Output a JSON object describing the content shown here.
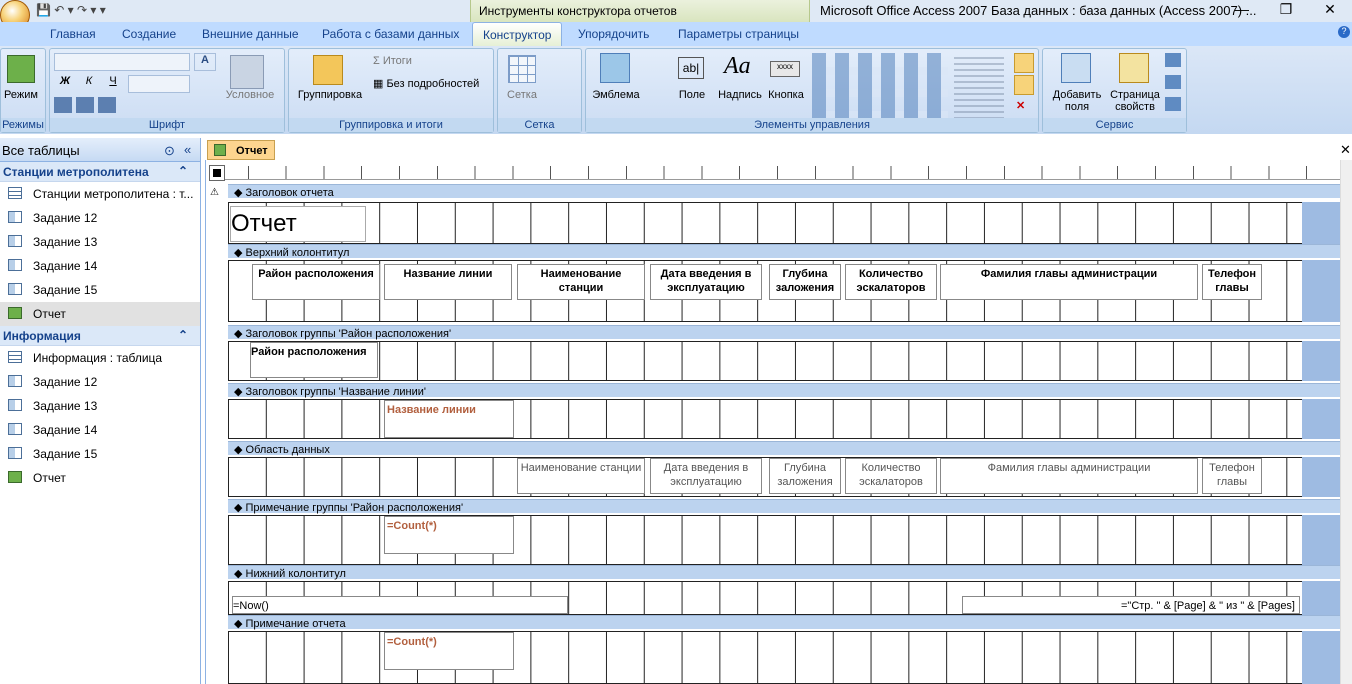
{
  "window": {
    "contextual_tools": "Инструменты конструктора отчетов",
    "title": "Microsoft Office Access 2007 База данных : база данных (Access 2007) ..."
  },
  "tabs": [
    "Главная",
    "Создание",
    "Внешние данные",
    "Работа с базами данных",
    "Конструктор",
    "Упорядочить",
    "Параметры страницы"
  ],
  "ribbon": {
    "groups": [
      "Режимы",
      "Шрифт",
      "Группировка и итоги",
      "Сетка",
      "Элементы управления",
      "Сервис"
    ],
    "view": "Режим",
    "conditional": "Условное",
    "grouping": "Группировка",
    "totals": "Итоги",
    "no_details": "Без подробностей",
    "grid": "Сетка",
    "logo": "Эмблема",
    "field": "Поле",
    "label": "Надпись",
    "button": "Кнопка",
    "add_fields": "Добавить поля",
    "property_sheet": "Страница свойств",
    "bold": "Ж",
    "italic": "К",
    "underline": "Ч"
  },
  "nav": {
    "header": "Все таблицы",
    "groups": [
      {
        "title": "Станции метрополитена",
        "items": [
          "Станции метрополитена : т...",
          "Задание 12",
          "Задание 13",
          "Задание 14",
          "Задание 15",
          "Отчет"
        ]
      },
      {
        "title": "Информация",
        "items": [
          "Информация : таблица",
          "Задание 12",
          "Задание 13",
          "Задание 14",
          "Задание 15",
          "Отчет"
        ]
      }
    ]
  },
  "doc": {
    "tab": "Отчет",
    "sections": [
      "Заголовок отчета",
      "Верхний колонтитул",
      "Заголовок группы 'Район расположения'",
      "Заголовок группы 'Название линии'",
      "Область данных",
      "Примечание группы 'Район расположения'",
      "Нижний колонтитул",
      "Примечание отчета"
    ],
    "report_title": "Отчет",
    "headers": [
      "Район расположения",
      "Название линии",
      "Наименование станции",
      "Дата введения в эксплуатацию",
      "Глубина заложения",
      "Количество эскалаторов",
      "Фамилия главы администрации",
      "Телефон главы"
    ],
    "group1": "Район расположения",
    "group2": "Название линии",
    "details": [
      "Наименование станции",
      "Дата введения в эксплуатацию",
      "Глубина заложения",
      "Количество эскалаторов",
      "Фамилия главы администрации",
      "Телефон главы"
    ],
    "count": "=Count(*)",
    "now": "=Now()",
    "page": "=\"Стр. \" & [Page] & \" из \" & [Pages]"
  }
}
